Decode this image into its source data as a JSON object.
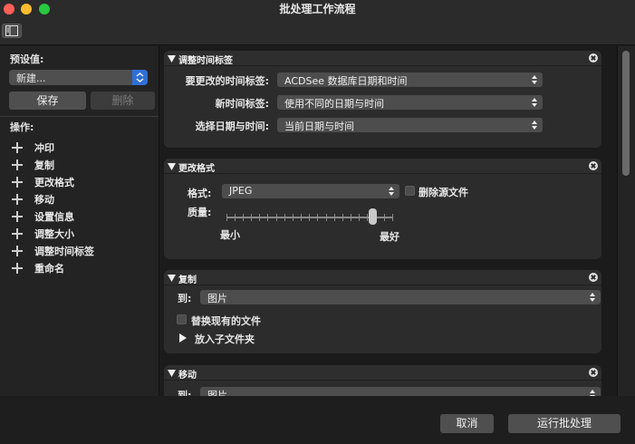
{
  "window": {
    "title": "批处理工作流程"
  },
  "sidebar": {
    "preset_label": "预设值:",
    "preset_value": "新建...",
    "save_label": "保存",
    "delete_label": "删除",
    "ops_label": "操作:",
    "operations": [
      "冲印",
      "复制",
      "更改格式",
      "移动",
      "设置信息",
      "调整大小",
      "调整时间标签",
      "重命名"
    ]
  },
  "panels": {
    "adjust_time": {
      "title": "调整时间标签",
      "field1_label": "要更改的时间标签:",
      "field1_value": "ACDSee 数据库日期和时间",
      "field2_label": "新时间标签:",
      "field2_value": "使用不同的日期与时间",
      "field3_label": "选择日期与时间:",
      "field3_value": "当前日期与时间"
    },
    "change_format": {
      "title": "更改格式",
      "format_label": "格式:",
      "format_value": "JPEG",
      "delete_source_label": "删除源文件",
      "quality_label": "质量:",
      "quality_min": "最小",
      "quality_max": "最好",
      "quality_level": 0.88
    },
    "copy": {
      "title": "复制",
      "to_label": "到:",
      "to_value": "图片",
      "replace_label": "替换现有的文件",
      "subfolder_label": "放入子文件夹"
    },
    "move": {
      "title": "移动",
      "to_label": "到:",
      "to_value": "图片"
    }
  },
  "footer": {
    "cancel_label": "取消",
    "run_label": "运行批处理"
  }
}
